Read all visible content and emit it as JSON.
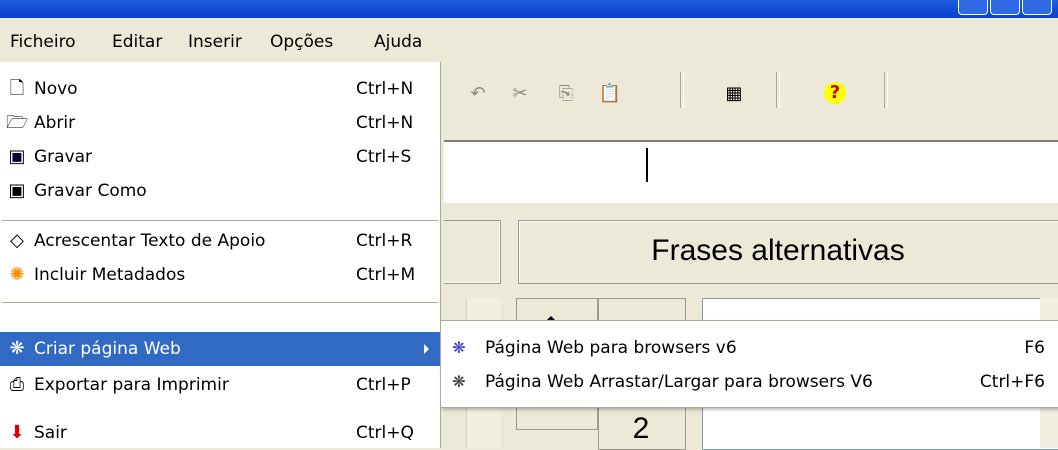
{
  "menubar": {
    "items": [
      "Ficheiro",
      "Editar",
      "Inserir",
      "Opções",
      "Ajuda"
    ]
  },
  "ficheiro_menu": {
    "items": [
      {
        "label": "Novo",
        "shortcut": "Ctrl+N",
        "icon": "new-document-icon"
      },
      {
        "label": "Abrir",
        "shortcut": "Ctrl+N",
        "icon": "open-folder-icon"
      },
      {
        "label": "Gravar",
        "shortcut": "Ctrl+S",
        "icon": "save-disk-icon"
      },
      {
        "label": "Gravar Como",
        "shortcut": "",
        "icon": "save-as-icon"
      },
      {
        "label": "Acrescentar Texto de Apoio",
        "shortcut": "Ctrl+R",
        "icon": "tag-icon"
      },
      {
        "label": "Incluir Metadados",
        "shortcut": "Ctrl+M",
        "icon": "metadata-icon"
      },
      {
        "label": "Criar página Web",
        "shortcut": "",
        "icon": "web-page-icon"
      },
      {
        "label": "Exportar para Imprimir",
        "shortcut": "Ctrl+P",
        "icon": "printer-icon"
      },
      {
        "label": "Sair",
        "shortcut": "Ctrl+Q",
        "icon": "exit-arrow-icon"
      }
    ]
  },
  "submenu": {
    "items": [
      {
        "label": "Página Web para browsers v6",
        "shortcut": "F6",
        "icon": "web-page-v6-icon"
      },
      {
        "label": "Página Web Arrastar/Largar para browsers V6",
        "shortcut": "Ctrl+F6",
        "icon": "web-dragdrop-v6-icon"
      }
    ]
  },
  "toolbar": {
    "icons": [
      "undo-icon",
      "cut-icon",
      "copy-icon",
      "paste-icon",
      "palette-icon",
      "help-icon"
    ]
  },
  "panel": {
    "title": "Frases alternativas",
    "number": "2"
  },
  "colors": {
    "highlight": "#316ac5",
    "menu_bg": "#ece9d8"
  }
}
